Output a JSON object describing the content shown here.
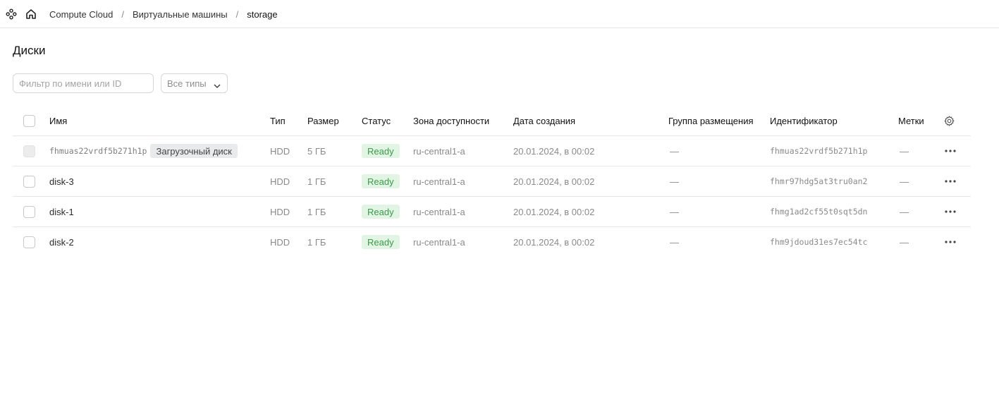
{
  "topbar": {
    "breadcrumbs": [
      "Compute Cloud",
      "Виртуальные машины",
      "storage"
    ],
    "separator": "/"
  },
  "page": {
    "title": "Диски"
  },
  "filters": {
    "search_placeholder": "Фильтр по имени или ID",
    "type_select": "Все типы"
  },
  "table": {
    "columns": [
      "Имя",
      "Тип",
      "Размер",
      "Статус",
      "Зона доступности",
      "Дата создания",
      "Группа размещения",
      "Идентификатор",
      "Метки"
    ],
    "rows": [
      {
        "name": "fhmuas22vrdf5b271h1p",
        "tag": "Загрузочный диск",
        "type": "HDD",
        "size": "5 ГБ",
        "status": "Ready",
        "zone": "ru-central1-a",
        "created": "20.01.2024, в 00:02",
        "group": "—",
        "id": "fhmuas22vrdf5b271h1p",
        "labels": "—"
      },
      {
        "name": "disk-3",
        "type": "HDD",
        "size": "1 ГБ",
        "status": "Ready",
        "zone": "ru-central1-a",
        "created": "20.01.2024, в 00:02",
        "group": "—",
        "id": "fhmr97hdg5at3tru0an2",
        "labels": "—"
      },
      {
        "name": "disk-1",
        "type": "HDD",
        "size": "1 ГБ",
        "status": "Ready",
        "zone": "ru-central1-a",
        "created": "20.01.2024, в 00:02",
        "group": "—",
        "id": "fhmg1ad2cf55t0sqt5dn",
        "labels": "—"
      },
      {
        "name": "disk-2",
        "type": "HDD",
        "size": "1 ГБ",
        "status": "Ready",
        "zone": "ru-central1-a",
        "created": "20.01.2024, в 00:02",
        "group": "—",
        "id": "fhm9jdoud31es7ec54tc",
        "labels": "—"
      }
    ]
  },
  "colors": {
    "status_bg": "#e2f4e4",
    "status_text": "#3c9a4a",
    "border": "#e7e7e7"
  },
  "icons": {
    "app": "services-icon",
    "home": "home-icon",
    "type_select": "chevron-down-icon",
    "settings": "gear-icon",
    "row_actions": "more-horizontal-icon"
  }
}
